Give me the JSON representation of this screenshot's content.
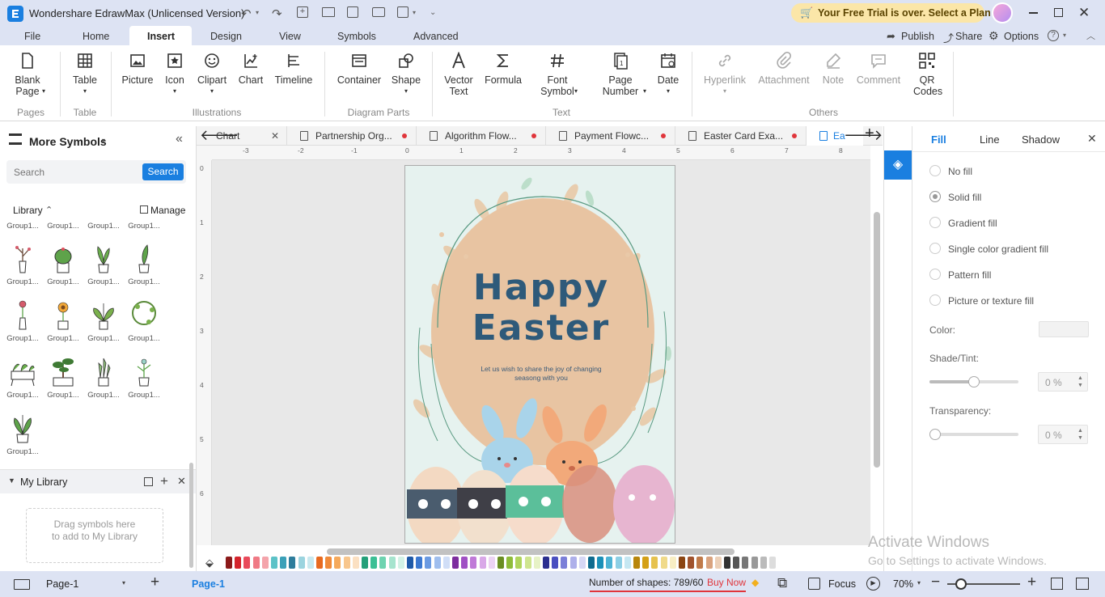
{
  "app": {
    "title": "Wondershare EdrawMax (Unlicensed Version)",
    "trial_banner": "Your Free Trial is over. Select a Plan"
  },
  "menu": {
    "items": [
      "File",
      "Home",
      "Insert",
      "Design",
      "View",
      "Symbols",
      "Advanced"
    ],
    "active": "Insert",
    "right": {
      "publish": "Publish",
      "share": "Share",
      "options": "Options"
    }
  },
  "ribbon": {
    "blank_page": "Blank Page",
    "table": "Table",
    "picture": "Picture",
    "icon": "Icon",
    "clipart": "Clipart",
    "chart": "Chart",
    "timeline": "Timeline",
    "container": "Container",
    "shape": "Shape",
    "vector_text": "Vector Text",
    "formula": "Formula",
    "font_symbol": "Font Symbol",
    "page_number": "Page Number",
    "date": "Date",
    "hyperlink": "Hyperlink",
    "attachment": "Attachment",
    "note": "Note",
    "comment": "Comment",
    "qr_codes": "QR Codes",
    "groups": {
      "pages": "Pages",
      "table": "Table",
      "illustrations": "Illustrations",
      "diagram_parts": "Diagram Parts",
      "text": "Text",
      "others": "Others"
    }
  },
  "left_panel": {
    "title": "More Symbols",
    "search_placeholder": "Search",
    "search_button": "Search",
    "library_label": "Library",
    "manage_label": "Manage",
    "symbol_label": "Group1...",
    "my_library": "My Library",
    "drop_hint": "Drag symbols here to add to My Library"
  },
  "tabs": [
    {
      "label": "Chart"
    },
    {
      "label": "Partnership Org..."
    },
    {
      "label": "Algorithm Flow..."
    },
    {
      "label": "Payment Flowc..."
    },
    {
      "label": "Easter Card Exa..."
    },
    {
      "label": "Ea"
    }
  ],
  "ruler": {
    "h": [
      "-3",
      "-2",
      "-1",
      "0",
      "1",
      "2",
      "3",
      "4",
      "5",
      "6",
      "7",
      "8"
    ],
    "v": [
      "0",
      "1",
      "2",
      "3",
      "4",
      "5",
      "6"
    ]
  },
  "card": {
    "line1": "Happy",
    "line2": "Easter",
    "message_line1": "Let us wish to share the joy of changing",
    "message_line2": "seasong with you"
  },
  "right_panel": {
    "tabs": [
      "Fill",
      "Line",
      "Shadow"
    ],
    "fill_options": [
      "No fill",
      "Solid fill",
      "Gradient fill",
      "Single color gradient fill",
      "Pattern fill",
      "Picture or texture fill"
    ],
    "selected_option": "Solid fill",
    "color_label": "Color:",
    "shade_label": "Shade/Tint:",
    "shade_value": "0 %",
    "transparency_label": "Transparency:",
    "transparency_value": "0 %"
  },
  "status": {
    "page_select": "Page-1",
    "page_tab": "Page-1",
    "shapes_text": "Number of shapes: 789/60",
    "buy_now": "Buy Now",
    "focus": "Focus",
    "zoom": "70%"
  },
  "watermark": {
    "line1": "Activate Windows",
    "line2": "Go to Settings to activate Windows."
  },
  "colors": {
    "accent": "#1a7fe0",
    "titlebar": "#dde3f3",
    "card_bg": "#e6f2ef",
    "egg": "#e8c4a2",
    "title_text": "#2e5a7a",
    "swatches": [
      "#8b1a1a",
      "#d4242c",
      "#e94a5b",
      "#f07a85",
      "#f4a4ab",
      "#5cc2c7",
      "#3aa0b8",
      "#2e7d9c",
      "#9bd4df",
      "#c9e9ef",
      "#e86a1f",
      "#f08a3a",
      "#f5a95c",
      "#f8c68d",
      "#fbe0c2",
      "#24a07a",
      "#3cbf95",
      "#6ed3b0",
      "#a6e4ce",
      "#d3f2e6",
      "#1f5aa8",
      "#3b78d0",
      "#6a9ae2",
      "#9fbeee",
      "#d0def7",
      "#7d2d9e",
      "#a050c4",
      "#c07ad8",
      "#d9a8e8",
      "#ecd3f3",
      "#6b8e23",
      "#8fbc3a",
      "#b0d45c",
      "#cfe58f",
      "#e7f2c6",
      "#2b2f8f",
      "#4a4fc0",
      "#7b7fd8",
      "#aeb0ea",
      "#d6d7f5",
      "#0e6b8f",
      "#1a90b8",
      "#4db3d4",
      "#8ccfe5",
      "#c5e7f2",
      "#b8860b",
      "#d4a017",
      "#e6c24f",
      "#f0da8a",
      "#f8eec4",
      "#8b4513",
      "#a0522d",
      "#c07a4a",
      "#d9a37f",
      "#ecd0b8",
      "#333333",
      "#555555",
      "#777777",
      "#999999",
      "#bbbbbb",
      "#dddddd"
    ]
  }
}
